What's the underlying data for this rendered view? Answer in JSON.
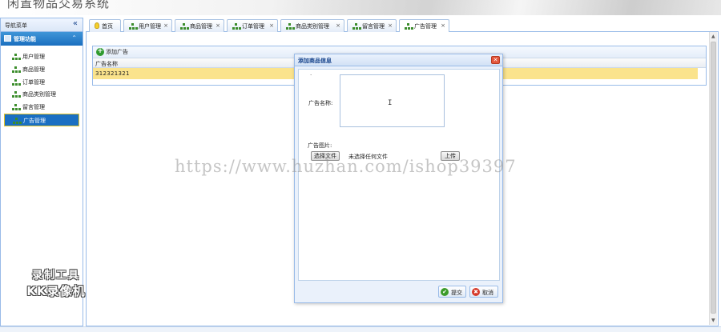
{
  "app": {
    "title": "闲置物品交易系统"
  },
  "nav": {
    "header": "导航菜单",
    "collapse_glyph": "«",
    "section_label": "管理功能",
    "section_toggle": "⌃",
    "items": [
      {
        "label": "用户管理"
      },
      {
        "label": "商品管理"
      },
      {
        "label": "订单管理"
      },
      {
        "label": "商品类别管理"
      },
      {
        "label": "留言管理"
      },
      {
        "label": "广告管理",
        "active": true
      }
    ]
  },
  "tabs": [
    {
      "label": "首页",
      "closable": false
    },
    {
      "label": "用户管理",
      "closable": true
    },
    {
      "label": "商品管理",
      "closable": true
    },
    {
      "label": "订单管理",
      "closable": true
    },
    {
      "label": "商品类别管理",
      "closable": true
    },
    {
      "label": "留言管理",
      "closable": true
    },
    {
      "label": "广告管理",
      "closable": true,
      "active": true
    }
  ],
  "tab_close_glyph": "×",
  "grid": {
    "add_button_label": "添加广告",
    "column_header": "广告名称",
    "rows": [
      {
        "name": "312321321"
      }
    ]
  },
  "dialog": {
    "title": "添加商品信息",
    "close_glyph": "✕",
    "name_label": "广告名称:",
    "image_label": "广告图片:",
    "choose_file_label": "选择文件",
    "no_file_text": "未选择任何文件",
    "upload_label": "上传",
    "submit_label": "提交",
    "cancel_label": "取消",
    "submit_glyph": "✔",
    "cancel_glyph": "✖"
  },
  "watermark": {
    "url": "https://www.huzhan.com/ishop39397",
    "kk_line1": "录制工具",
    "kk_line2": "KK录像机"
  },
  "colors": {
    "accent_blue": "#1b6fbf",
    "border_blue": "#99bbe8",
    "selected_row": "#fae38c",
    "close_red": "#e4573d"
  }
}
